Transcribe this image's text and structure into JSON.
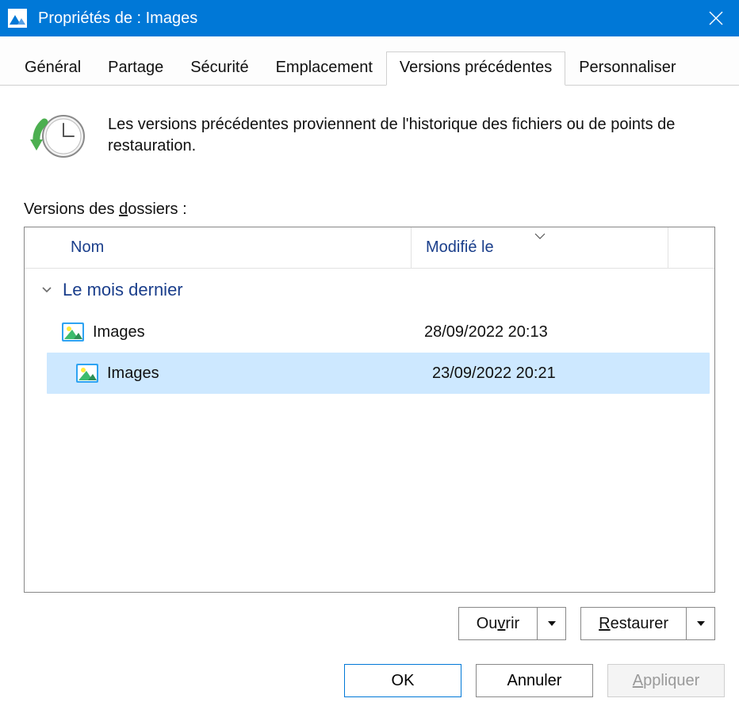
{
  "titlebar": {
    "title": "Propriétés de : Images"
  },
  "tabs": {
    "items": [
      {
        "label": "Général",
        "active": false
      },
      {
        "label": "Partage",
        "active": false
      },
      {
        "label": "Sécurité",
        "active": false
      },
      {
        "label": "Emplacement",
        "active": false
      },
      {
        "label": "Versions précédentes",
        "active": true
      },
      {
        "label": "Personnaliser",
        "active": false
      }
    ]
  },
  "description": "Les versions précédentes proviennent de l'historique des fichiers ou de points de restauration.",
  "section_label_pre": "Versions des ",
  "section_label_u": "d",
  "section_label_post": "ossiers :",
  "columns": {
    "name": "Nom",
    "modified": "Modifié le"
  },
  "group_label": "Le mois dernier",
  "items": [
    {
      "name": "Images",
      "modified": "28/09/2022 20:13",
      "selected": false
    },
    {
      "name": "Images",
      "modified": "23/09/2022 20:21",
      "selected": true
    }
  ],
  "actions": {
    "open_pre": "Ou",
    "open_u": "v",
    "open_post": "rir",
    "restore_u": "R",
    "restore_post": "estaurer"
  },
  "footer": {
    "ok": "OK",
    "cancel": "Annuler",
    "apply_u": "A",
    "apply_post": "ppliquer"
  }
}
